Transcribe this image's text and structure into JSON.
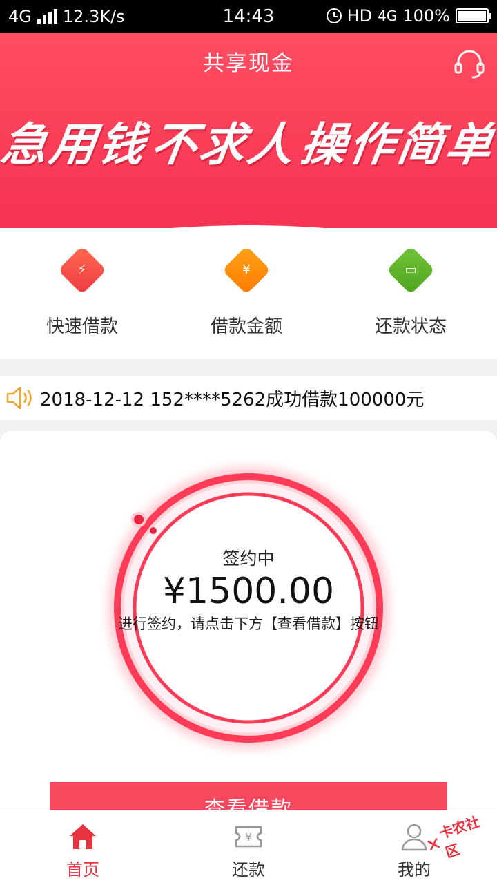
{
  "status_bar": {
    "network": "4G",
    "speed": "12.3K/s",
    "time": "14:43",
    "hd": "HD",
    "network_right": "4G",
    "battery": "100%"
  },
  "header": {
    "title": "共享现金",
    "slogan": [
      "急用钱",
      "不求人",
      "操作简单"
    ],
    "colors": {
      "primary": "#f8485e",
      "header_bg": "#ff4d61"
    }
  },
  "quick_nav": [
    {
      "label": "快速借款",
      "icon": "lightning-icon",
      "color": "#f1484a"
    },
    {
      "label": "借款金额",
      "icon": "diamond-icon",
      "color": "#ff8a00"
    },
    {
      "label": "还款状态",
      "icon": "card-icon",
      "color": "#5cb22a"
    }
  ],
  "notice": {
    "icon": "speaker-icon",
    "text": "2018-12-12 152****5262成功借款100000元"
  },
  "loan_card": {
    "status": "签约中",
    "amount": "¥1500.00",
    "hint": "进行签约，请点击下方【查看借款】按钮",
    "button_label": "查看借款"
  },
  "tab_bar": [
    {
      "label": "首页",
      "icon": "home-icon",
      "active": true
    },
    {
      "label": "还款",
      "icon": "repay-ticket-icon",
      "active": false
    },
    {
      "label": "我的",
      "icon": "user-icon",
      "active": false
    }
  ],
  "watermark": "卡农社区"
}
